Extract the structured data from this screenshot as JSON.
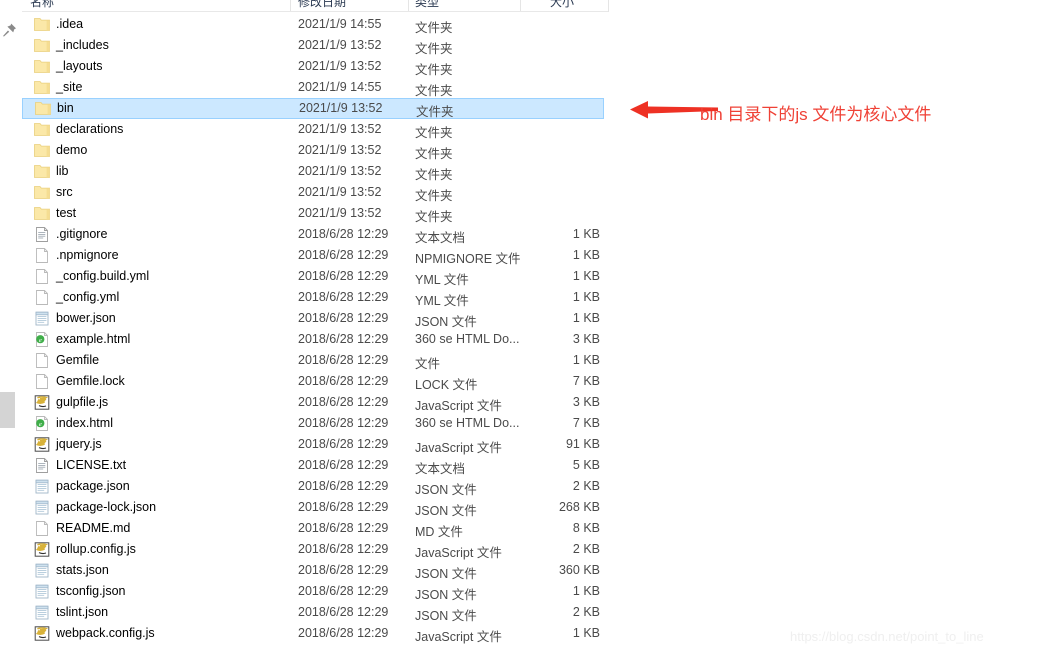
{
  "window": {
    "kind": "windows-file-explorer-list",
    "selection_color": "#cce8ff",
    "selection_border": "#99d1ff",
    "folder_icon_color": "#fbe6a2",
    "annotation_color": "#ef4136"
  },
  "columns": {
    "name_header": "名称",
    "date_header": "修改日期",
    "type_header": "类型",
    "size_header": "大小"
  },
  "rows": [
    {
      "name": ".idea",
      "date": "2021/1/9 14:55",
      "type": "文件夹",
      "size": "",
      "icon": "folder-icon",
      "selected": false
    },
    {
      "name": "_includes",
      "date": "2021/1/9 13:52",
      "type": "文件夹",
      "size": "",
      "icon": "folder-icon",
      "selected": false
    },
    {
      "name": "_layouts",
      "date": "2021/1/9 13:52",
      "type": "文件夹",
      "size": "",
      "icon": "folder-icon",
      "selected": false
    },
    {
      "name": "_site",
      "date": "2021/1/9 14:55",
      "type": "文件夹",
      "size": "",
      "icon": "folder-icon",
      "selected": false
    },
    {
      "name": "bin",
      "date": "2021/1/9 13:52",
      "type": "文件夹",
      "size": "",
      "icon": "folder-icon",
      "selected": true
    },
    {
      "name": "declarations",
      "date": "2021/1/9 13:52",
      "type": "文件夹",
      "size": "",
      "icon": "folder-icon",
      "selected": false
    },
    {
      "name": "demo",
      "date": "2021/1/9 13:52",
      "type": "文件夹",
      "size": "",
      "icon": "folder-icon",
      "selected": false
    },
    {
      "name": "lib",
      "date": "2021/1/9 13:52",
      "type": "文件夹",
      "size": "",
      "icon": "folder-icon",
      "selected": false
    },
    {
      "name": "src",
      "date": "2021/1/9 13:52",
      "type": "文件夹",
      "size": "",
      "icon": "folder-icon",
      "selected": false
    },
    {
      "name": "test",
      "date": "2021/1/9 13:52",
      "type": "文件夹",
      "size": "",
      "icon": "folder-icon",
      "selected": false
    },
    {
      "name": ".gitignore",
      "date": "2018/6/28 12:29",
      "type": "文本文档",
      "size": "1 KB",
      "icon": "text-document-icon",
      "selected": false
    },
    {
      "name": ".npmignore",
      "date": "2018/6/28 12:29",
      "type": "NPMIGNORE 文件",
      "size": "1 KB",
      "icon": "blank-file-icon",
      "selected": false
    },
    {
      "name": "_config.build.yml",
      "date": "2018/6/28 12:29",
      "type": "YML 文件",
      "size": "1 KB",
      "icon": "blank-file-icon",
      "selected": false
    },
    {
      "name": "_config.yml",
      "date": "2018/6/28 12:29",
      "type": "YML 文件",
      "size": "1 KB",
      "icon": "blank-file-icon",
      "selected": false
    },
    {
      "name": "bower.json",
      "date": "2018/6/28 12:29",
      "type": "JSON 文件",
      "size": "1 KB",
      "icon": "notepad-icon",
      "selected": false
    },
    {
      "name": "example.html",
      "date": "2018/6/28 12:29",
      "type": "360 se HTML Do...",
      "size": "3 KB",
      "icon": "html-file-icon",
      "selected": false
    },
    {
      "name": "Gemfile",
      "date": "2018/6/28 12:29",
      "type": "文件",
      "size": "1 KB",
      "icon": "blank-file-icon",
      "selected": false
    },
    {
      "name": "Gemfile.lock",
      "date": "2018/6/28 12:29",
      "type": "LOCK 文件",
      "size": "7 KB",
      "icon": "blank-file-icon",
      "selected": false
    },
    {
      "name": "gulpfile.js",
      "date": "2018/6/28 12:29",
      "type": "JavaScript 文件",
      "size": "3 KB",
      "icon": "javascript-icon",
      "selected": false
    },
    {
      "name": "index.html",
      "date": "2018/6/28 12:29",
      "type": "360 se HTML Do...",
      "size": "7 KB",
      "icon": "html-file-icon",
      "selected": false
    },
    {
      "name": "jquery.js",
      "date": "2018/6/28 12:29",
      "type": "JavaScript 文件",
      "size": "91 KB",
      "icon": "javascript-icon",
      "selected": false
    },
    {
      "name": "LICENSE.txt",
      "date": "2018/6/28 12:29",
      "type": "文本文档",
      "size": "5 KB",
      "icon": "text-document-icon",
      "selected": false
    },
    {
      "name": "package.json",
      "date": "2018/6/28 12:29",
      "type": "JSON 文件",
      "size": "2 KB",
      "icon": "notepad-icon",
      "selected": false
    },
    {
      "name": "package-lock.json",
      "date": "2018/6/28 12:29",
      "type": "JSON 文件",
      "size": "268 KB",
      "icon": "notepad-icon",
      "selected": false
    },
    {
      "name": "README.md",
      "date": "2018/6/28 12:29",
      "type": "MD 文件",
      "size": "8 KB",
      "icon": "blank-file-icon",
      "selected": false
    },
    {
      "name": "rollup.config.js",
      "date": "2018/6/28 12:29",
      "type": "JavaScript 文件",
      "size": "2 KB",
      "icon": "javascript-icon",
      "selected": false
    },
    {
      "name": "stats.json",
      "date": "2018/6/28 12:29",
      "type": "JSON 文件",
      "size": "360 KB",
      "icon": "notepad-icon",
      "selected": false
    },
    {
      "name": "tsconfig.json",
      "date": "2018/6/28 12:29",
      "type": "JSON 文件",
      "size": "1 KB",
      "icon": "notepad-icon",
      "selected": false
    },
    {
      "name": "tslint.json",
      "date": "2018/6/28 12:29",
      "type": "JSON 文件",
      "size": "2 KB",
      "icon": "notepad-icon",
      "selected": false
    },
    {
      "name": "webpack.config.js",
      "date": "2018/6/28 12:29",
      "type": "JavaScript 文件",
      "size": "1 KB",
      "icon": "javascript-icon",
      "selected": false
    }
  ],
  "annotation": {
    "text": "bin 目录下的js 文件为核心文件",
    "arrow": "left-arrow-icon",
    "color": "#ef4136"
  },
  "watermark": {
    "text": "https://blog.csdn.net/point_to_line"
  },
  "gutter": {
    "pin_icon": "pushpin-icon",
    "scrollbar": "vertical-scrollbar"
  }
}
